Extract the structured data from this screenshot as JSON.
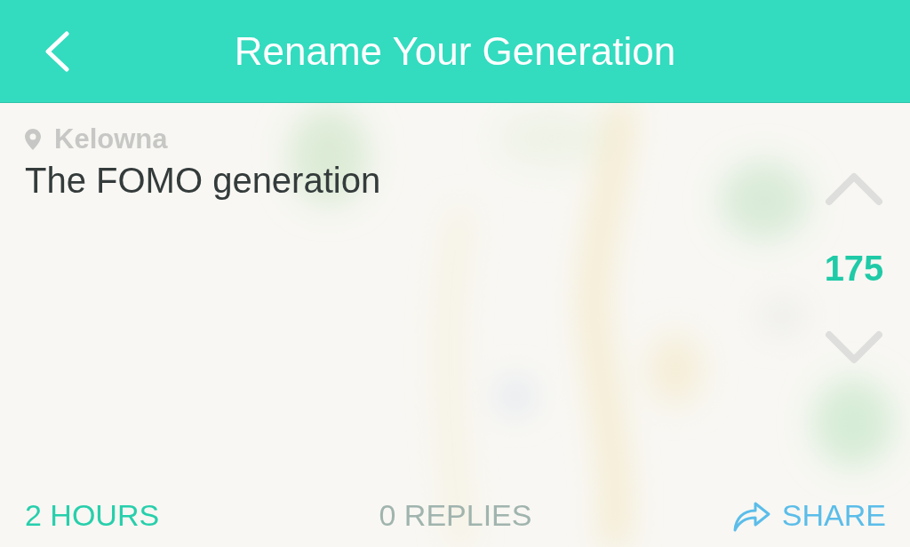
{
  "header": {
    "title": "Rename Your Generation"
  },
  "post": {
    "location": "Kelowna",
    "message": "The FOMO generation",
    "votes": "175"
  },
  "footer": {
    "time": "2 HOURS",
    "replies": "0 REPLIES",
    "share": "SHARE"
  }
}
